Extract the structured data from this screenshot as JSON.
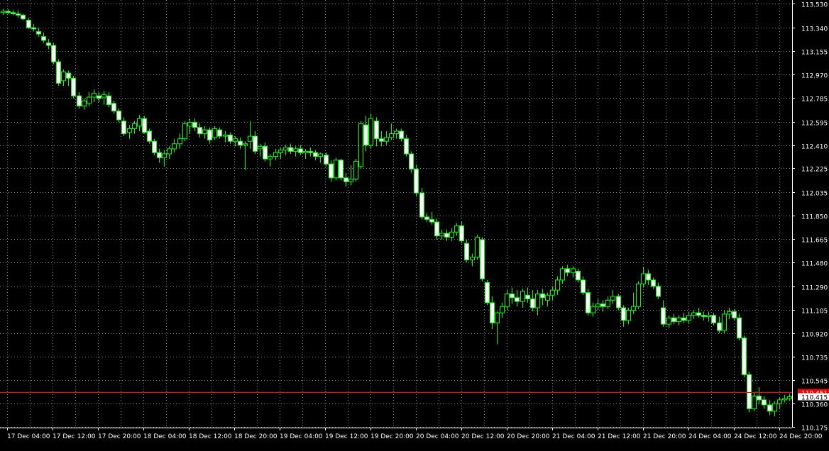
{
  "chart_data": {
    "type": "candlestick",
    "y_ticks": [
      113.53,
      113.34,
      113.155,
      112.97,
      112.785,
      112.595,
      112.41,
      112.225,
      112.035,
      111.85,
      111.665,
      111.48,
      111.29,
      111.105,
      110.92,
      110.735,
      110.545,
      110.36,
      110.175
    ],
    "y_tick_labels": [
      "113.530",
      "113.340",
      "113.155",
      "112.970",
      "112.785",
      "112.595",
      "112.410",
      "112.225",
      "112.035",
      "111.850",
      "111.665",
      "111.480",
      "111.290",
      "111.105",
      "110.920",
      "110.735",
      "110.545",
      "110.360",
      "110.175"
    ],
    "x_tick_labels": [
      "17 Dec 04:00",
      "17 Dec 12:00",
      "17 Dec 20:00",
      "18 Dec 04:00",
      "18 Dec 12:00",
      "18 Dec 20:00",
      "19 Dec 04:00",
      "19 Dec 12:00",
      "19 Dec 20:00",
      "20 Dec 04:00",
      "20 Dec 12:00",
      "20 Dec 20:00",
      "21 Dec 04:00",
      "21 Dec 12:00",
      "21 Dec 20:00",
      "24 Dec 04:00",
      "24 Dec 12:00",
      "24 Dec 20:00"
    ],
    "ylim": [
      110.17,
      113.56
    ],
    "grid": true,
    "bid_line": 110.451,
    "bid_label": "110.451",
    "current_price": 110.415,
    "current_price_label": "110.415",
    "colors": {
      "background": "#000000",
      "candle": "#00ff00",
      "candle_fill": "#ffffff",
      "grid": "#c0c0c0",
      "axis_text": "#ffffff",
      "bid_line": "#ff0000"
    },
    "candles_ohlc": [
      [
        113.46,
        113.49,
        113.44,
        113.47
      ],
      [
        113.47,
        113.49,
        113.45,
        113.46
      ],
      [
        113.46,
        113.48,
        113.44,
        113.45
      ],
      [
        113.45,
        113.48,
        113.42,
        113.44
      ],
      [
        113.44,
        113.45,
        113.4,
        113.41
      ],
      [
        113.4,
        113.42,
        113.33,
        113.34
      ],
      [
        113.34,
        113.37,
        113.31,
        113.33
      ],
      [
        113.31,
        113.34,
        113.27,
        113.29
      ],
      [
        113.27,
        113.3,
        113.22,
        113.24
      ],
      [
        113.22,
        113.25,
        113.17,
        113.2
      ],
      [
        113.2,
        113.22,
        113.05,
        113.07
      ],
      [
        113.07,
        113.09,
        112.88,
        112.9
      ],
      [
        112.92,
        113.01,
        112.88,
        112.99
      ],
      [
        112.98,
        113.0,
        112.88,
        112.94
      ],
      [
        112.94,
        112.96,
        112.78,
        112.8
      ],
      [
        112.8,
        112.83,
        112.7,
        112.72
      ],
      [
        112.72,
        112.78,
        112.69,
        112.76
      ],
      [
        112.74,
        112.83,
        112.72,
        112.79
      ],
      [
        112.79,
        112.85,
        112.75,
        112.82
      ],
      [
        112.8,
        112.83,
        112.75,
        112.78
      ],
      [
        112.79,
        112.84,
        112.73,
        112.81
      ],
      [
        112.8,
        112.83,
        112.71,
        112.73
      ],
      [
        112.74,
        112.76,
        112.66,
        112.68
      ],
      [
        112.68,
        112.7,
        112.59,
        112.61
      ],
      [
        112.6,
        112.63,
        112.48,
        112.5
      ],
      [
        112.51,
        112.57,
        112.46,
        112.54
      ],
      [
        112.54,
        112.6,
        112.5,
        112.58
      ],
      [
        112.56,
        112.65,
        112.52,
        112.62
      ],
      [
        112.62,
        112.64,
        112.5,
        112.51
      ],
      [
        112.52,
        112.54,
        112.42,
        112.44
      ],
      [
        112.44,
        112.46,
        112.33,
        112.35
      ],
      [
        112.35,
        112.38,
        112.27,
        112.31
      ],
      [
        112.31,
        112.37,
        112.24,
        112.34
      ],
      [
        112.34,
        112.4,
        112.3,
        112.38
      ],
      [
        112.38,
        112.46,
        112.35,
        112.42
      ],
      [
        112.42,
        112.5,
        112.38,
        112.46
      ],
      [
        112.46,
        112.6,
        112.44,
        112.58
      ],
      [
        112.56,
        112.62,
        112.5,
        112.59
      ],
      [
        112.59,
        112.62,
        112.52,
        112.55
      ],
      [
        112.55,
        112.58,
        112.47,
        112.5
      ],
      [
        112.5,
        112.56,
        112.46,
        112.53
      ],
      [
        112.53,
        112.55,
        112.42,
        112.45
      ],
      [
        112.47,
        112.56,
        112.45,
        112.54
      ],
      [
        112.53,
        112.55,
        112.46,
        112.48
      ],
      [
        112.48,
        112.52,
        112.43,
        112.49
      ],
      [
        112.49,
        112.51,
        112.42,
        112.44
      ],
      [
        112.44,
        112.48,
        112.4,
        112.46
      ],
      [
        112.44,
        112.47,
        112.38,
        112.41
      ],
      [
        112.41,
        112.44,
        112.21,
        112.42
      ],
      [
        112.44,
        112.6,
        112.38,
        112.48
      ],
      [
        112.48,
        112.52,
        112.34,
        112.36
      ],
      [
        112.38,
        112.42,
        112.32,
        112.4
      ],
      [
        112.4,
        112.43,
        112.28,
        112.3
      ],
      [
        112.3,
        112.34,
        112.24,
        112.32
      ],
      [
        112.32,
        112.38,
        112.29,
        112.35
      ],
      [
        112.35,
        112.39,
        112.3,
        112.37
      ],
      [
        112.37,
        112.41,
        112.33,
        112.39
      ],
      [
        112.39,
        112.42,
        112.34,
        112.36
      ],
      [
        112.36,
        112.4,
        112.32,
        112.38
      ],
      [
        112.38,
        112.41,
        112.33,
        112.35
      ],
      [
        112.35,
        112.38,
        112.3,
        112.36
      ],
      [
        112.36,
        112.39,
        112.32,
        112.35
      ],
      [
        112.35,
        112.37,
        112.29,
        112.32
      ],
      [
        112.32,
        112.35,
        112.27,
        112.34
      ],
      [
        112.33,
        112.35,
        112.24,
        112.26
      ],
      [
        112.26,
        112.29,
        112.12,
        112.15
      ],
      [
        112.15,
        112.31,
        112.13,
        112.29
      ],
      [
        112.29,
        112.3,
        112.13,
        112.15
      ],
      [
        112.15,
        112.19,
        112.08,
        112.12
      ],
      [
        112.12,
        112.25,
        112.09,
        112.14
      ],
      [
        112.14,
        112.3,
        112.12,
        112.28
      ],
      [
        112.24,
        112.6,
        112.22,
        112.58
      ],
      [
        112.57,
        112.64,
        112.36,
        112.41
      ],
      [
        112.41,
        112.66,
        112.38,
        112.62
      ],
      [
        112.6,
        112.63,
        112.4,
        112.46
      ],
      [
        112.46,
        112.52,
        112.4,
        112.44
      ],
      [
        112.44,
        112.52,
        112.41,
        112.47
      ],
      [
        112.47,
        112.58,
        112.45,
        112.5
      ],
      [
        112.5,
        112.54,
        112.46,
        112.52
      ],
      [
        112.52,
        112.54,
        112.44,
        112.46
      ],
      [
        112.46,
        112.49,
        112.32,
        112.34
      ],
      [
        112.34,
        112.36,
        112.19,
        112.22
      ],
      [
        112.22,
        112.25,
        112.0,
        112.03
      ],
      [
        112.03,
        112.07,
        111.82,
        111.84
      ],
      [
        111.84,
        111.87,
        111.8,
        111.82
      ],
      [
        111.82,
        111.88,
        111.78,
        111.8
      ],
      [
        111.8,
        111.83,
        111.66,
        111.69
      ],
      [
        111.69,
        111.74,
        111.66,
        111.71
      ],
      [
        111.71,
        111.74,
        111.65,
        111.68
      ],
      [
        111.68,
        111.75,
        111.65,
        111.72
      ],
      [
        111.72,
        111.79,
        111.69,
        111.77
      ],
      [
        111.77,
        111.8,
        111.63,
        111.65
      ],
      [
        111.63,
        111.66,
        111.48,
        111.5
      ],
      [
        111.5,
        111.55,
        111.45,
        111.52
      ],
      [
        111.52,
        111.7,
        111.5,
        111.68
      ],
      [
        111.66,
        111.68,
        111.33,
        111.35
      ],
      [
        111.32,
        111.34,
        111.14,
        111.16
      ],
      [
        111.16,
        111.21,
        110.95,
        111.0
      ],
      [
        111.0,
        111.09,
        110.83,
        111.08
      ],
      [
        111.08,
        111.16,
        111.04,
        111.13
      ],
      [
        111.13,
        111.26,
        111.1,
        111.23
      ],
      [
        111.23,
        111.28,
        111.15,
        111.2
      ],
      [
        111.2,
        111.26,
        111.13,
        111.17
      ],
      [
        111.17,
        111.27,
        111.12,
        111.25
      ],
      [
        111.22,
        111.28,
        111.16,
        111.19
      ],
      [
        111.19,
        111.26,
        111.09,
        111.12
      ],
      [
        111.12,
        111.26,
        111.06,
        111.23
      ],
      [
        111.23,
        111.27,
        111.14,
        111.2
      ],
      [
        111.18,
        111.24,
        111.13,
        111.22
      ],
      [
        111.22,
        111.29,
        111.18,
        111.26
      ],
      [
        111.26,
        111.37,
        111.22,
        111.34
      ],
      [
        111.34,
        111.45,
        111.31,
        111.43
      ],
      [
        111.43,
        111.46,
        111.37,
        111.4
      ],
      [
        111.4,
        111.45,
        111.36,
        111.43
      ],
      [
        111.41,
        111.43,
        111.32,
        111.34
      ],
      [
        111.34,
        111.37,
        111.22,
        111.24
      ],
      [
        111.24,
        111.27,
        111.06,
        111.08
      ],
      [
        111.08,
        111.16,
        111.05,
        111.13
      ],
      [
        111.13,
        111.19,
        111.1,
        111.15
      ],
      [
        111.15,
        111.18,
        111.09,
        111.13
      ],
      [
        111.13,
        111.21,
        111.11,
        111.18
      ],
      [
        111.18,
        111.26,
        111.15,
        111.21
      ],
      [
        111.21,
        111.23,
        111.1,
        111.12
      ],
      [
        111.12,
        111.14,
        110.97,
        111.02
      ],
      [
        111.02,
        111.12,
        110.99,
        111.1
      ],
      [
        111.1,
        111.24,
        111.07,
        111.13
      ],
      [
        111.13,
        111.33,
        111.11,
        111.31
      ],
      [
        111.31,
        111.44,
        111.28,
        111.39
      ],
      [
        111.39,
        111.42,
        111.3,
        111.34
      ],
      [
        111.34,
        111.36,
        111.27,
        111.29
      ],
      [
        111.29,
        111.32,
        111.19,
        111.21
      ],
      [
        111.12,
        111.18,
        110.97,
        110.99
      ],
      [
        110.99,
        111.06,
        110.96,
        111.04
      ],
      [
        111.04,
        111.07,
        110.99,
        111.01
      ],
      [
        111.01,
        111.06,
        110.98,
        111.04
      ],
      [
        111.04,
        111.08,
        111.0,
        111.02
      ],
      [
        111.02,
        111.09,
        110.99,
        111.06
      ],
      [
        111.06,
        111.1,
        111.03,
        111.08
      ],
      [
        111.08,
        111.12,
        111.04,
        111.06
      ],
      [
        111.06,
        111.09,
        111.02,
        111.05
      ],
      [
        111.05,
        111.09,
        111.01,
        111.06
      ],
      [
        111.06,
        111.08,
        110.98,
        111.0
      ],
      [
        111.0,
        111.05,
        110.92,
        110.94
      ],
      [
        110.94,
        111.1,
        110.92,
        111.07
      ],
      [
        111.07,
        111.12,
        111.03,
        111.09
      ],
      [
        111.09,
        111.11,
        111.02,
        111.04
      ],
      [
        111.04,
        111.07,
        110.86,
        110.88
      ],
      [
        110.88,
        110.9,
        110.57,
        110.59
      ],
      [
        110.59,
        110.61,
        110.29,
        110.32
      ],
      [
        110.32,
        110.45,
        110.3,
        110.42
      ],
      [
        110.42,
        110.49,
        110.36,
        110.39
      ],
      [
        110.39,
        110.42,
        110.32,
        110.35
      ],
      [
        110.35,
        110.39,
        110.27,
        110.3
      ],
      [
        110.3,
        110.38,
        110.26,
        110.36
      ],
      [
        110.36,
        110.41,
        110.32,
        110.39
      ],
      [
        110.39,
        110.43,
        110.37,
        110.4
      ],
      [
        110.4,
        110.44,
        110.38,
        110.415
      ]
    ]
  }
}
